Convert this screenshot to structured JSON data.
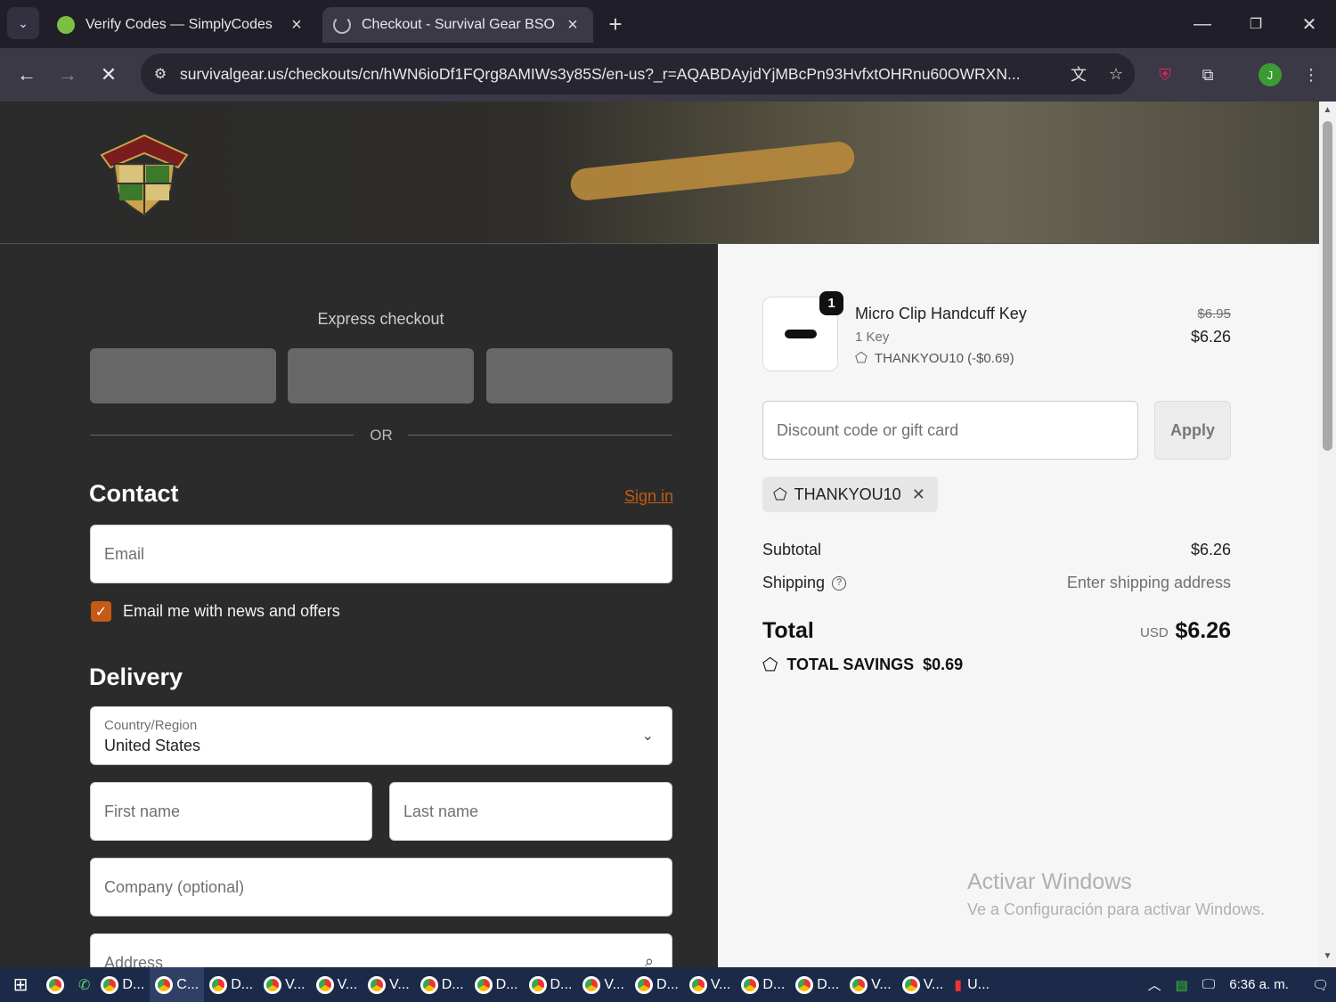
{
  "browser": {
    "tabs": [
      {
        "title": "Verify Codes — SimplyCodes",
        "favicon": "simplycodes-icon"
      },
      {
        "title": "Checkout - Survival Gear BSO",
        "favicon": "loading-icon"
      }
    ],
    "url": "survivalgear.us/checkouts/cn/hWN6ioDf1FQrg8AMIWs3y85S/en-us?_r=AQABDAyjdYjMBcPn93HvfxtOHRnu60OWRXN...",
    "profile_initial": "J"
  },
  "checkout": {
    "express_title": "Express checkout",
    "or_text": "OR",
    "contact": {
      "heading": "Contact",
      "sign_in": "Sign in",
      "email_placeholder": "Email",
      "newsletter_label": "Email me with news and offers"
    },
    "delivery": {
      "heading": "Delivery",
      "country_label": "Country/Region",
      "country_value": "United States",
      "first_name_placeholder": "First name",
      "last_name_placeholder": "Last name",
      "company_placeholder": "Company (optional)",
      "address_placeholder": "Address"
    }
  },
  "summary": {
    "item": {
      "quantity": "1",
      "name": "Micro Clip Handcuff Key",
      "variant": "1 Key",
      "discount": "THANKYOU10 (-$0.69)",
      "original_price": "$6.95",
      "price": "$6.26"
    },
    "discount_placeholder": "Discount code or gift card",
    "apply_label": "Apply",
    "applied_code": "THANKYOU10",
    "subtotal_label": "Subtotal",
    "subtotal_value": "$6.26",
    "shipping_label": "Shipping",
    "shipping_value": "Enter shipping address",
    "total_label": "Total",
    "total_currency": "USD",
    "total_value": "$6.26",
    "savings_label": "TOTAL SAVINGS",
    "savings_value": "$0.69"
  },
  "watermark": {
    "line1": "Activar Windows",
    "line2": "Ve a Configuración para activar Windows."
  },
  "taskbar": {
    "items": [
      "D...",
      "C...",
      "D...",
      "V...",
      "V...",
      "V...",
      "D...",
      "D...",
      "D...",
      "V...",
      "D...",
      "V...",
      "D...",
      "D...",
      "V...",
      "V...",
      "U..."
    ],
    "clock": "6:36 a. m."
  },
  "colors": {
    "accent": "#c45a13",
    "left_bg": "#2b2b2b",
    "right_bg": "#f6f6f6",
    "taskbar": "#1c2a4a"
  }
}
